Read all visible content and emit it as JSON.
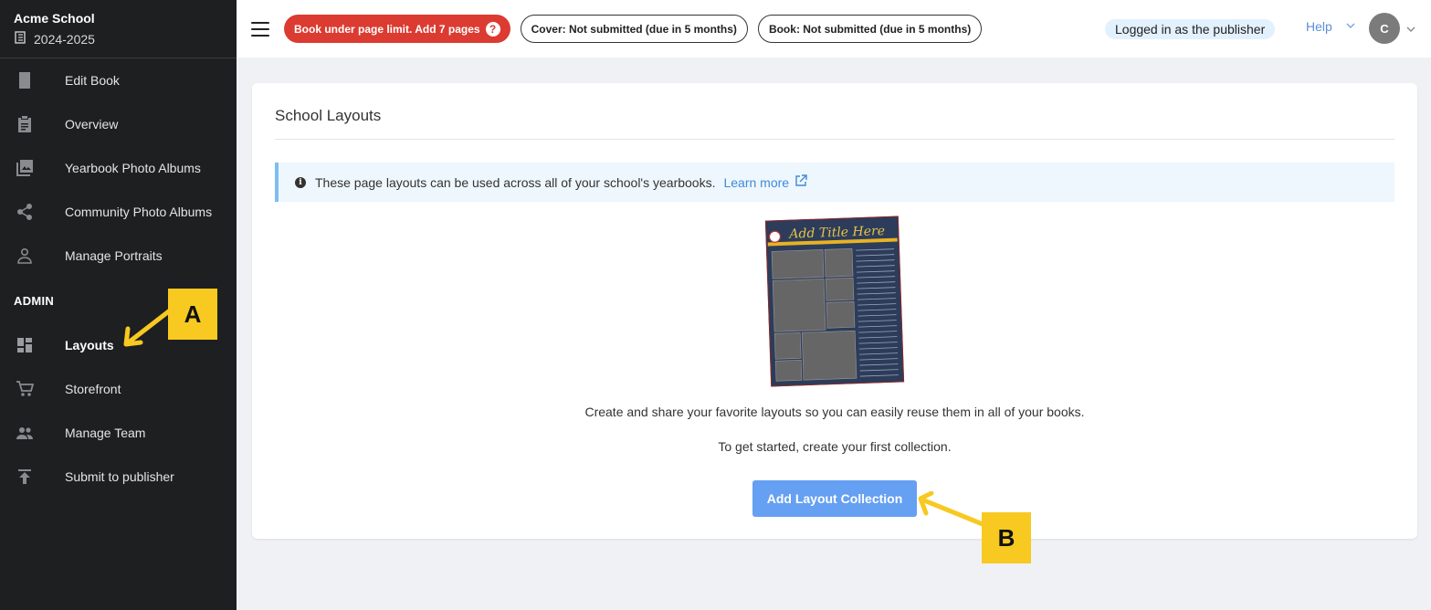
{
  "school": {
    "name": "Acme School",
    "year": "2024-2025"
  },
  "sidebar": {
    "items": [
      {
        "label": "Edit Book",
        "icon": "book-icon"
      },
      {
        "label": "Overview",
        "icon": "clipboard-icon"
      },
      {
        "label": "Yearbook Photo Albums",
        "icon": "photo-album-icon"
      },
      {
        "label": "Community Photo Albums",
        "icon": "share-icon"
      },
      {
        "label": "Manage Portraits",
        "icon": "person-icon"
      }
    ],
    "admin_label": "ADMIN",
    "admin_items": [
      {
        "label": "Layouts",
        "icon": "dashboard-icon"
      },
      {
        "label": "Storefront",
        "icon": "cart-icon"
      },
      {
        "label": "Manage Team",
        "icon": "team-icon"
      },
      {
        "label": "Submit to publisher",
        "icon": "upload-icon"
      }
    ]
  },
  "topbar": {
    "page_limit": "Book under page limit. Add 7 pages",
    "cover_status": "Cover: Not submitted (due in 5 months)",
    "book_status": "Book: Not submitted (due in 5 months)",
    "logged_in": "Logged in as the publisher",
    "help": "Help",
    "avatar": "C"
  },
  "main": {
    "title": "School Layouts",
    "info_text": "These page layouts can be used across all of your school's yearbooks.",
    "learn_more": "Learn more",
    "thumbnail_title": "Add Title Here",
    "description": "Create and share your favorite layouts so you can easily reuse them in all of your books.",
    "get_started": "To get started, create your first collection.",
    "add_button": "Add Layout Collection"
  },
  "annotations": {
    "a": "A",
    "b": "B"
  },
  "colors": {
    "sidebar_bg": "#1e1f21",
    "alert_red": "#dc3b31",
    "primary_blue": "#65a0f2",
    "callout_yellow": "#f7c921"
  }
}
